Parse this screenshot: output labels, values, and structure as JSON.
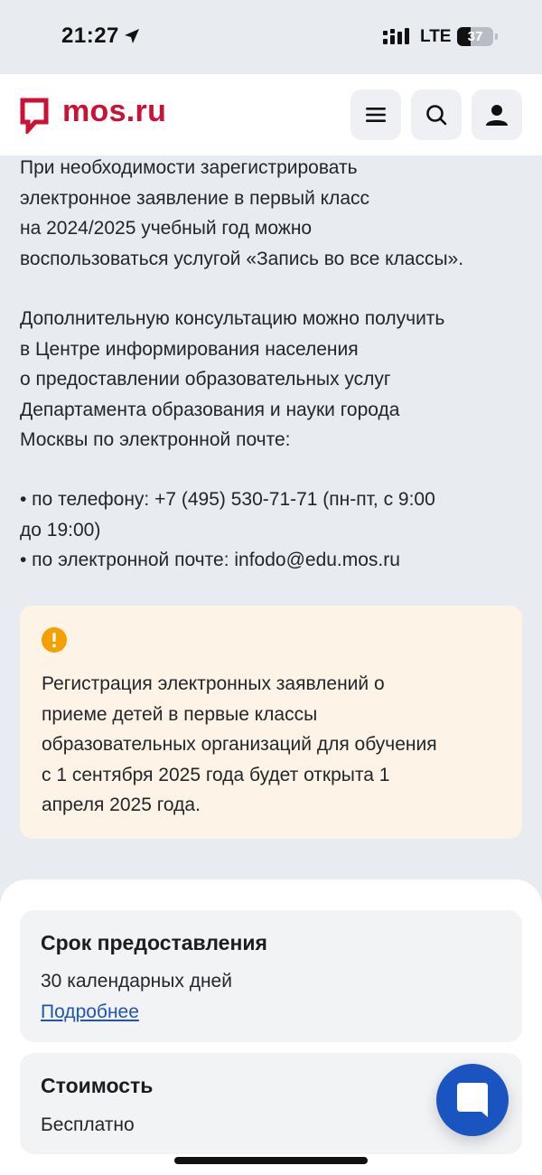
{
  "status_bar": {
    "time": "21:27",
    "network": "LTE",
    "battery_percent": 37,
    "battery_label": "37"
  },
  "header": {
    "logo_text": "mos.ru",
    "brand_color": "#cc1136",
    "icons": [
      "menu-icon",
      "search-icon",
      "user-icon"
    ]
  },
  "content": {
    "paragraph_1": [
      "При необходимости зарегистрировать",
      "электронное заявление в первый класс",
      "на 2024/2025 учебный год можно",
      "воспользоваться услугой «Запись во все классы»."
    ],
    "paragraph_2": [
      "Дополнительную консультацию можно получить",
      "в Центре информирования населения",
      "о предоставлении образовательных услуг",
      "Департамента образования и науки города",
      "Москвы по электронной почте:"
    ],
    "contacts": [
      "• по телефону: +7 (495) 530-71-71 (пн-пт, с 9:00",
      "до 19:00)",
      "• по электронной почте: infodo@edu.mos.ru"
    ]
  },
  "alert": {
    "icon": "warning-icon",
    "icon_color": "#f4a100",
    "lines": [
      "Регистрация электронных заявлений о",
      "приеме детей в первые классы",
      "образовательных организаций для обучения",
      "с 1 сентября 2025 года будет открыта 1",
      "апреля 2025 года."
    ]
  },
  "cards": {
    "term": {
      "title": "Срок предоставления",
      "value": "30 календарных дней",
      "link": "Подробнее"
    },
    "cost": {
      "title": "Стоимость",
      "value": "Бесплатно"
    }
  },
  "chat_button": {
    "icon": "chat-icon",
    "color": "#1a54c0"
  }
}
